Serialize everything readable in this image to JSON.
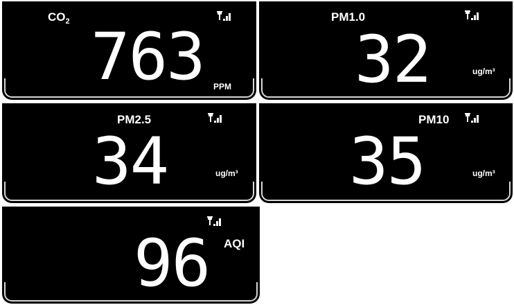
{
  "panels": {
    "co2": {
      "label_main": "CO",
      "label_sub": "2",
      "value": "763",
      "unit": "PPM"
    },
    "pm1": {
      "label": "PM1.0",
      "value": "32",
      "unit": "ug/m³"
    },
    "pm25": {
      "label": "PM2.5",
      "value": "34",
      "unit": "ug/m³"
    },
    "pm10": {
      "label": "PM10",
      "value": "35",
      "unit": "ug/m³"
    },
    "aqi": {
      "value": "96",
      "unit": "AQI"
    }
  },
  "icons": {
    "signal": "signal-strength-icon"
  },
  "colors": {
    "panel_background": "#000000",
    "text": "#ffffff",
    "page_background": "#ffffff"
  }
}
